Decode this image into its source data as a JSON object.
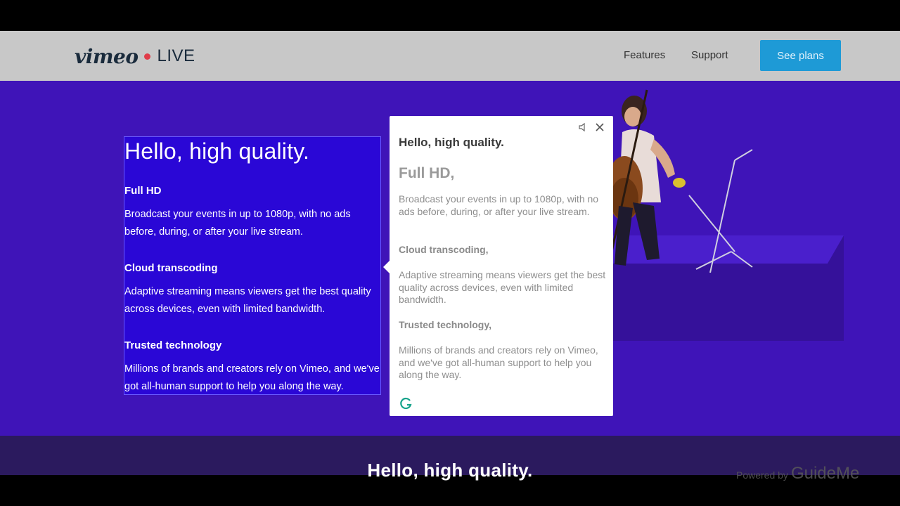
{
  "nav": {
    "logo_word": "vimeo",
    "logo_product": "LIVE",
    "links": [
      "Features",
      "Support"
    ],
    "cta": "See plans"
  },
  "highlight": {
    "title": "Hello, high quality.",
    "sections": [
      {
        "heading": "Full HD",
        "text": "Broadcast your events in up to 1080p, with no ads before, during, or after your live stream."
      },
      {
        "heading": "Cloud transcoding",
        "text": "Adaptive streaming means viewers get the best quality across devices, even with limited bandwidth."
      },
      {
        "heading": "Trusted technology",
        "text": "Millions of brands and creators rely on Vimeo, and we've got all-human support to help you along the way."
      }
    ]
  },
  "popup": {
    "title": "Hello, high quality.",
    "sections": [
      {
        "heading": "Full HD,",
        "text": "Broadcast your events in up to 1080p, with no ads before, during, or after your live stream."
      },
      {
        "heading": "Cloud transcoding,",
        "text": "Adaptive streaming means viewers get the best quality across devices, even with limited bandwidth."
      },
      {
        "heading": "Trusted technology,",
        "text": "Millions of brands and creators rely on Vimeo, and we've got all-human support to help you along the way."
      }
    ]
  },
  "caption": "Hello, high quality.",
  "watermark": {
    "prefix": "Powered by",
    "brand": "GuideMe"
  },
  "colors": {
    "hero": "#3f14b8",
    "highlight": "#2a07d6",
    "cta": "#1e9ad6",
    "logo_dot": "#e03d4a"
  },
  "icons": [
    "mute-icon",
    "close-icon",
    "grammarly-icon"
  ]
}
